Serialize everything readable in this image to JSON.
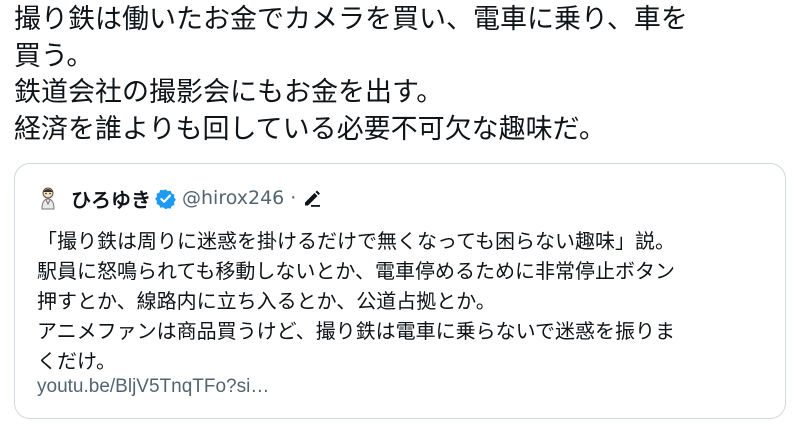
{
  "tweet": {
    "lines": [
      "撮り鉄は働いたお金でカメラを買い、電車に乗り、車を",
      "買う。",
      "鉄道会社の撮影会にもお金を出す。",
      "経済を誰よりも回している必要不可欠な趣味だ。"
    ]
  },
  "quote": {
    "display_name": "ひろゆき",
    "handle": "@hirox246",
    "separator": "·",
    "icons": {
      "avatar": "avatar-illustration",
      "verified": "verified-badge-icon",
      "edit": "edit-pencil-icon"
    },
    "lines": [
      "「撮り鉄は周りに迷惑を掛けるだけで無くなっても困らない趣味」説。",
      "駅員に怒鳴られても移動しないとか、電車停めるために非常停止ボタン",
      "押すとか、線路内に立ち入るとか、公道占拠とか。",
      "アニメファンは商品買うけど、撮り鉄は電車に乗らないで迷惑を振りま",
      "くだけ。"
    ],
    "link": "youtu.be/BljV5TnqTFo?si…"
  },
  "colors": {
    "text": "#0f1419",
    "secondary": "#536471",
    "border": "#cfd9de",
    "verified": "#1d9bf0"
  }
}
